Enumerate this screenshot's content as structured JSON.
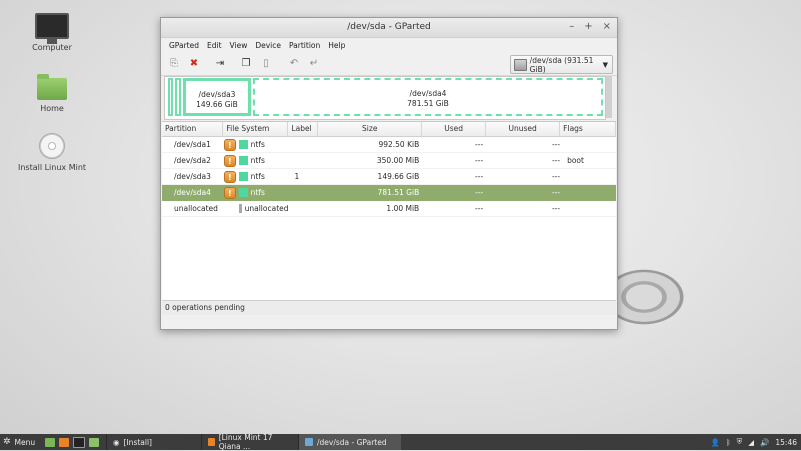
{
  "desktop": {
    "icons": [
      {
        "label": "Computer"
      },
      {
        "label": "Home"
      },
      {
        "label": "Install Linux Mint"
      }
    ]
  },
  "window": {
    "title": "/dev/sda - GParted",
    "controls": {
      "minimize": "–",
      "maximize": "+",
      "close": "×"
    },
    "menu": [
      "GParted",
      "Edit",
      "View",
      "Device",
      "Partition",
      "Help"
    ],
    "device_selector": {
      "value": "/dev/sda   (931.51 GiB)"
    },
    "diskmap": {
      "sda3": {
        "name": "/dev/sda3",
        "size": "149.66 GiB"
      },
      "sda4": {
        "name": "/dev/sda4",
        "size": "781.51 GiB"
      }
    },
    "columns": [
      "Partition",
      "File System",
      "Label",
      "Size",
      "Used",
      "Unused",
      "Flags"
    ],
    "rows": [
      {
        "partition": "/dev/sda1",
        "fs": "ntfs",
        "label": "",
        "size": "992.50 KiB",
        "used": "---",
        "unused": "---",
        "flags": "",
        "color": "#4ed8a0",
        "lock": true
      },
      {
        "partition": "/dev/sda2",
        "fs": "ntfs",
        "label": "",
        "size": "350.00 MiB",
        "used": "---",
        "unused": "---",
        "flags": "boot",
        "color": "#4ed8a0",
        "lock": true
      },
      {
        "partition": "/dev/sda3",
        "fs": "ntfs",
        "label": "1",
        "size": "149.66 GiB",
        "used": "---",
        "unused": "---",
        "flags": "",
        "color": "#4ed8a0",
        "lock": true
      },
      {
        "partition": "/dev/sda4",
        "fs": "ntfs",
        "label": "",
        "size": "781.51 GiB",
        "used": "---",
        "unused": "---",
        "flags": "",
        "color": "#4ed8a0",
        "lock": true,
        "selected": true
      },
      {
        "partition": "unallocated",
        "fs": "unallocated",
        "label": "",
        "size": "1.00 MiB",
        "used": "---",
        "unused": "---",
        "flags": "",
        "color": "#a8a8a8",
        "lock": false
      }
    ],
    "status": "0 operations pending"
  },
  "taskbar": {
    "menu_label": "Menu",
    "tasks": [
      {
        "label": "[Install]"
      },
      {
        "label": "[Linux Mint 17 Qiana ..."
      },
      {
        "label": "/dev/sda - GParted",
        "active": true
      }
    ],
    "clock": "15:46"
  },
  "colors": {
    "selection": "#8fac6c",
    "ntfs": "#4ed8a0",
    "partition_border": "#6de0ab",
    "taskbar": "#3c3c3c"
  }
}
